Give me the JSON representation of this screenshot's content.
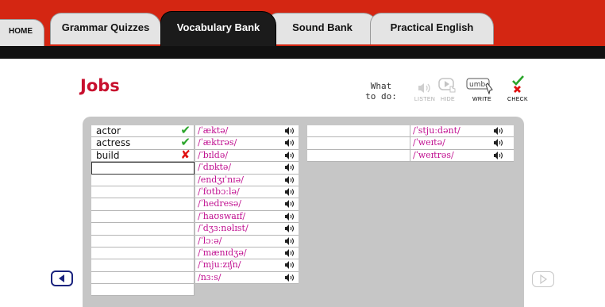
{
  "nav": {
    "tabs": [
      {
        "label": "HOME"
      },
      {
        "label": "Grammar Quizzes"
      },
      {
        "label": "Vocabulary Bank",
        "active": true
      },
      {
        "label": "Sound Bank"
      },
      {
        "label": "Practical English"
      }
    ]
  },
  "page": {
    "title": "Jobs"
  },
  "toolbar": {
    "what_to_do_line1": "What",
    "what_to_do_line2": "to do:",
    "listen": {
      "label": "LISTEN",
      "icon": "speaker-icon"
    },
    "hide": {
      "label": "HIDE",
      "icon": "play-hand-icon"
    },
    "write": {
      "label": "WRITE",
      "icon": "pencil-text-icon",
      "icon_text": "umb"
    },
    "check": {
      "label": "CHECK",
      "icon": "check-cross-icon"
    }
  },
  "words": [
    {
      "text": "actor",
      "mark": "correct"
    },
    {
      "text": "actress",
      "mark": "correct"
    },
    {
      "text": "build",
      "mark": "incorrect"
    },
    {
      "text": "",
      "mark": ""
    },
    {
      "text": "",
      "mark": ""
    },
    {
      "text": "",
      "mark": ""
    },
    {
      "text": "",
      "mark": ""
    },
    {
      "text": "",
      "mark": ""
    },
    {
      "text": "",
      "mark": ""
    },
    {
      "text": "",
      "mark": ""
    },
    {
      "text": "",
      "mark": ""
    },
    {
      "text": "",
      "mark": ""
    },
    {
      "text": "",
      "mark": ""
    },
    {
      "text": "",
      "mark": ""
    }
  ],
  "ipa_col1": [
    "/ˈæktə/",
    "/ˈæktrəs/",
    "/ˈbɪldə/",
    "/ˈdɒktə/",
    "/endʒɪˈnɪə/",
    "/ˈfʊtbɔːlə/",
    "/ˈhedresə/",
    "/ˈhaʊswaɪf/",
    "/ˈdʒɜːnəlɪst/",
    "/ˈlɔːə/",
    "/ˈmænɪdʒə/",
    "/ˈmjuːzɪʃn/",
    "/nɜːs/"
  ],
  "ipa_col2": [
    "/ˈstjuːdənt/",
    "/ˈweɪtə/",
    "/ˈweɪtrəs/"
  ],
  "colors": {
    "brand_red": "#d42612",
    "ipa_magenta": "#c01090",
    "check_green": "#2aa52a",
    "cross_red": "#e01010"
  }
}
